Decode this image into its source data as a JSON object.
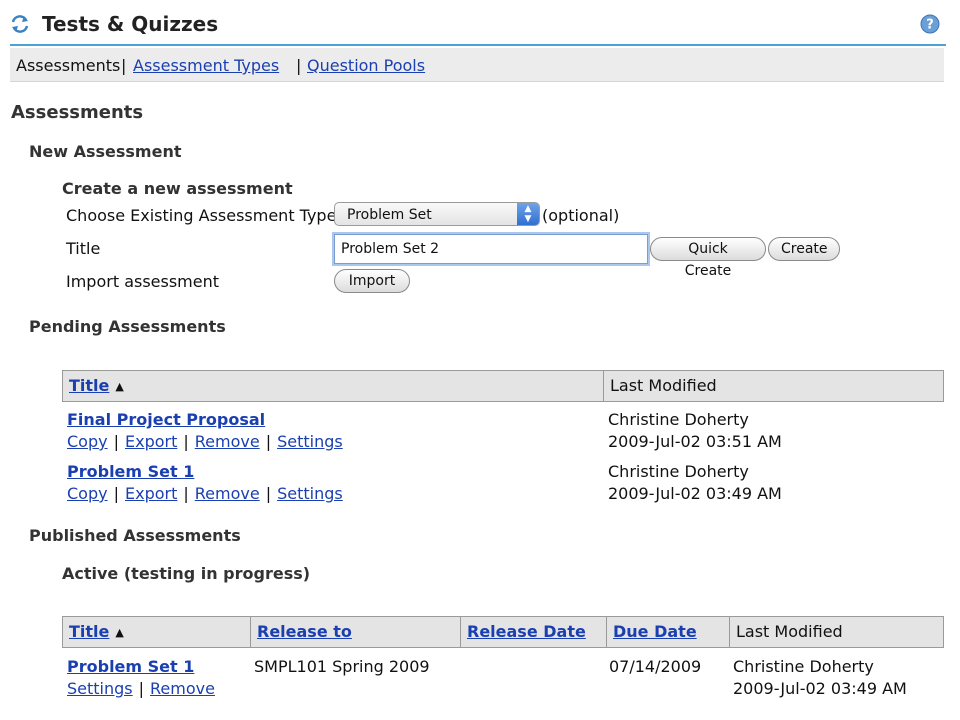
{
  "app": {
    "title": "Tests & Quizzes"
  },
  "nav": {
    "current": "Assessments",
    "sep": "|",
    "types": "Assessment Types",
    "pools": "Question Pools"
  },
  "page": {
    "heading": "Assessments"
  },
  "new_assessment": {
    "heading": "New Assessment",
    "subheading": "Create a new assessment",
    "type_label": "Choose Existing Assessment Type",
    "type_value": "Problem Set",
    "optional": "(optional)",
    "title_label": "Title",
    "title_value": "Problem Set 2",
    "quick_create": "Quick Create",
    "create": "Create",
    "import_label": "Import assessment",
    "import_button": "Import"
  },
  "pending": {
    "heading": "Pending Assessments",
    "columns": {
      "title": "Title",
      "last_modified": "Last Modified"
    },
    "rows": [
      {
        "title": "Final Project Proposal",
        "links": [
          "Copy",
          "Export",
          "Remove",
          "Settings"
        ],
        "author": "Christine Doherty",
        "date": "2009-Jul-02 03:51 AM"
      },
      {
        "title": "Problem Set 1",
        "links": [
          "Copy",
          "Export",
          "Remove",
          "Settings"
        ],
        "author": "Christine Doherty",
        "date": "2009-Jul-02 03:49 AM"
      }
    ]
  },
  "published": {
    "heading": "Published Assessments",
    "subheading": "Active (testing in progress)",
    "columns": {
      "title": "Title",
      "release_to": "Release to",
      "release_date": "Release Date",
      "due_date": "Due Date",
      "last_modified": "Last Modified"
    },
    "rows": [
      {
        "title": "Problem Set 1",
        "links": [
          "Settings",
          "Remove"
        ],
        "release_to": "SMPL101 Spring 2009",
        "release_date": "",
        "due_date": "07/14/2009",
        "author": "Christine Doherty",
        "date": "2009-Jul-02 03:49 AM"
      }
    ]
  },
  "colors": {
    "accent": "#4aa3d4",
    "link": "#1a3fb0",
    "header_bg": "#e4e4e4"
  },
  "icons": {
    "reload": "reload-arrows-icon",
    "help": "help-question-icon",
    "sort": "sort-ascending-icon"
  }
}
